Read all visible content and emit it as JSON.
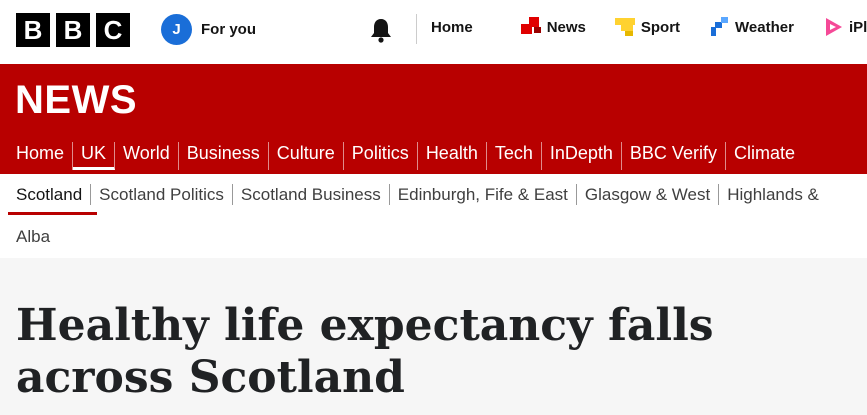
{
  "header": {
    "logo_letters": [
      "B",
      "B",
      "C"
    ],
    "account": {
      "avatar_initial": "J",
      "label": "For you"
    },
    "nav": [
      {
        "label": "Home",
        "icon": ""
      },
      {
        "label": "News",
        "icon": "news-icon",
        "color": "#e00000"
      },
      {
        "label": "Sport",
        "icon": "sport-icon",
        "color": "#ffd230"
      },
      {
        "label": "Weather",
        "icon": "weather-icon",
        "color": "#1a6ed8"
      },
      {
        "label": "iPlayer",
        "icon": "iplayer-icon",
        "color": "#f54997"
      }
    ]
  },
  "brand": {
    "title": "NEWS",
    "color": "#b80000"
  },
  "main_nav": {
    "items": [
      "Home",
      "UK",
      "World",
      "Business",
      "Culture",
      "Politics",
      "Health",
      "Tech",
      "InDepth",
      "BBC Verify",
      "Climate"
    ],
    "active": "UK"
  },
  "sub_nav": {
    "items": [
      "Scotland",
      "Scotland Politics",
      "Scotland Business",
      "Edinburgh, Fife & East",
      "Glasgow & West",
      "Highlands &"
    ],
    "active": "Scotland",
    "row2": "Alba"
  },
  "article": {
    "headline": "Healthy life expectancy falls across Scotland"
  }
}
